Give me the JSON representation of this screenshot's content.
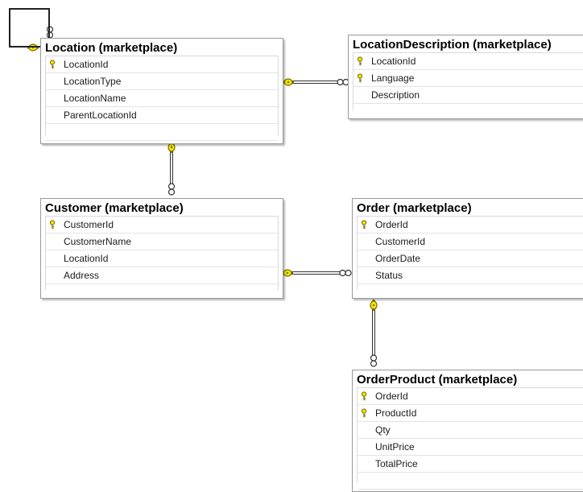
{
  "tables": [
    {
      "id": "location",
      "title": "Location (marketplace)",
      "rows": [
        {
          "name": "LocationId",
          "key": true
        },
        {
          "name": "LocationType",
          "key": false
        },
        {
          "name": "LocationName",
          "key": false
        },
        {
          "name": "ParentLocationId",
          "key": false
        }
      ]
    },
    {
      "id": "locationdescription",
      "title": "LocationDescription (marketplace)",
      "rows": [
        {
          "name": "LocationId",
          "key": true
        },
        {
          "name": "Language",
          "key": true
        },
        {
          "name": "Description",
          "key": false
        }
      ]
    },
    {
      "id": "customer",
      "title": "Customer (marketplace)",
      "rows": [
        {
          "name": "CustomerId",
          "key": true
        },
        {
          "name": "CustomerName",
          "key": false
        },
        {
          "name": "LocationId",
          "key": false
        },
        {
          "name": "Address",
          "key": false
        }
      ]
    },
    {
      "id": "order",
      "title": "Order (marketplace)",
      "rows": [
        {
          "name": "OrderId",
          "key": true
        },
        {
          "name": "CustomerId",
          "key": false
        },
        {
          "name": "OrderDate",
          "key": false
        },
        {
          "name": "Status",
          "key": false
        }
      ]
    },
    {
      "id": "orderproduct",
      "title": "OrderProduct (marketplace)",
      "rows": [
        {
          "name": "OrderId",
          "key": true
        },
        {
          "name": "ProductId",
          "key": true
        },
        {
          "name": "Qty",
          "key": false
        },
        {
          "name": "UnitPrice",
          "key": false
        },
        {
          "name": "TotalPrice",
          "key": false
        }
      ]
    }
  ],
  "relationships": [
    {
      "from": "location",
      "to": "location",
      "name": "location-self-reference"
    },
    {
      "from": "location",
      "to": "locationdescription",
      "name": "location-to-locationdescription"
    },
    {
      "from": "location",
      "to": "customer",
      "name": "location-to-customer"
    },
    {
      "from": "customer",
      "to": "order",
      "name": "customer-to-order"
    },
    {
      "from": "order",
      "to": "orderproduct",
      "name": "order-to-orderproduct"
    }
  ],
  "colors": {
    "key_icon": "#f2e600",
    "key_outline": "#7a6a00",
    "connector": "#333333",
    "table_border": "#9a9a9a"
  }
}
